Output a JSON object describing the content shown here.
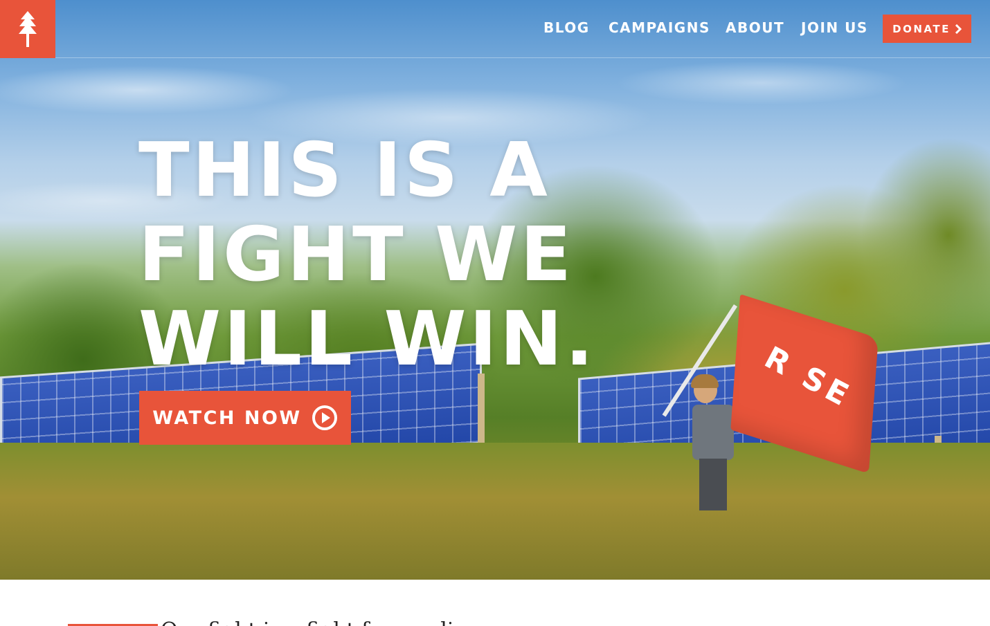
{
  "header": {
    "logo_icon": "pine-tree-icon",
    "nav": [
      {
        "label": "BLOG"
      },
      {
        "label": "CAMPAIGNS"
      },
      {
        "label": "ABOUT"
      },
      {
        "label": "JOIN US"
      }
    ],
    "donate_label": "DONATE",
    "donate_icon": "chevron-right-icon"
  },
  "hero": {
    "headline": [
      "THIS IS A",
      "FIGHT WE",
      "WILL WIN."
    ],
    "cta_label": "WATCH NOW",
    "cta_icon": "play-circle-icon",
    "flag_text": "R SE",
    "flag_icon": "pine-tree-icon"
  },
  "below": {
    "text": "Our fight is a fight for our lives"
  },
  "colors": {
    "accent": "#e8543a",
    "text_light": "#ffffff"
  }
}
